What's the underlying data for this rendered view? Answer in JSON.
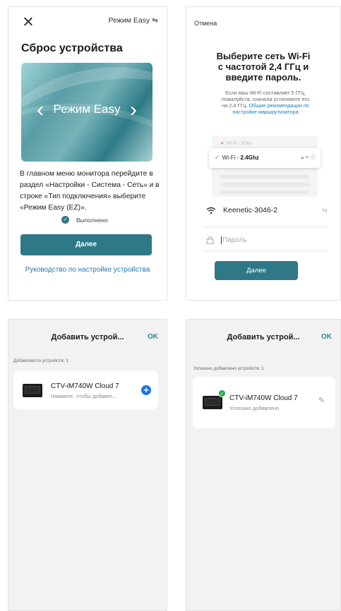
{
  "screen1": {
    "close_icon": "close-icon",
    "mode_label": "Режим Easy",
    "mode_icon": "swap-icon",
    "title": "Сброс устройства",
    "hero_text": "Режим Easy",
    "instruction": "В главном меню монитора перейдите в раздел «Настройки - Система - Сеть» и в строке «Тип подключения» выберите «Режим Easy (EZ)».",
    "done_label": "Выполнено",
    "next_label": "Далее",
    "guide_link": "Руководство по настройке устройства"
  },
  "screen2": {
    "cancel_label": "Отмена",
    "title_line1": "Выберите сеть Wi-Fi",
    "title_line2": "с частотой 2,4 ГГц и",
    "title_line3": "введите пароль.",
    "note_line1": "Если ваш Wi-Fi составляет 5 ГГц,",
    "note_line2": "пожалуйста, сначала установите его",
    "note_line3a": "на 2,4 ГГц.",
    "note_link_a": "Общие рекомендации по",
    "note_link_b": "настройке маршрутизатора",
    "wifi_5ghz": "Wi-Fi - 5Ghz",
    "wifi_24_prefix": "Wi-Fi - ",
    "wifi_24_bold": "2.4Ghz",
    "ssid": "Keenetic-3046-2",
    "password_placeholder": "Пароль",
    "next_label": "Далее"
  },
  "screen3": {
    "title": "Добавить устрой...",
    "ok_label": "OK",
    "status": "Добавляется устройств: 1",
    "device_name": "CTV-iM740W Cloud 7",
    "device_hint": "Нажмите, чтобы добавит..."
  },
  "screen4": {
    "title": "Добавить устрой...",
    "ok_label": "OK",
    "status": "Успешно добавлено устройств: 1",
    "device_name": "CTV-iM740W Cloud 7",
    "device_status": "Успешно добавлено"
  },
  "colors": {
    "accent": "#2f7888",
    "link": "#1f7ab5",
    "ok_text": "#2f8a9c",
    "success": "#2aa84a",
    "add_button": "#1f74d8",
    "list_bg": "#f2f2f2"
  }
}
